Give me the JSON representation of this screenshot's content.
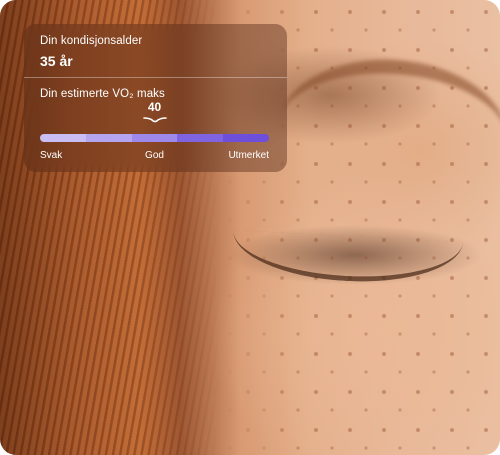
{
  "card": {
    "fitness_age_label": "Din kondisjonsalder",
    "fitness_age_value": "35 år",
    "vo2_label": "Din estimerte VO₂ maks",
    "vo2_value": "40",
    "vo2_position_fraction": 0.5,
    "scale": {
      "low": "Svak",
      "mid": "God",
      "high": "Utmerket",
      "segment_colors": [
        "#c9bdf3",
        "#b5a4ef",
        "#9e89ea",
        "#7f63e0",
        "#6d4fdb"
      ]
    }
  },
  "colors": {
    "card_text": "#ffffff",
    "accent": "#6d4fdb"
  }
}
